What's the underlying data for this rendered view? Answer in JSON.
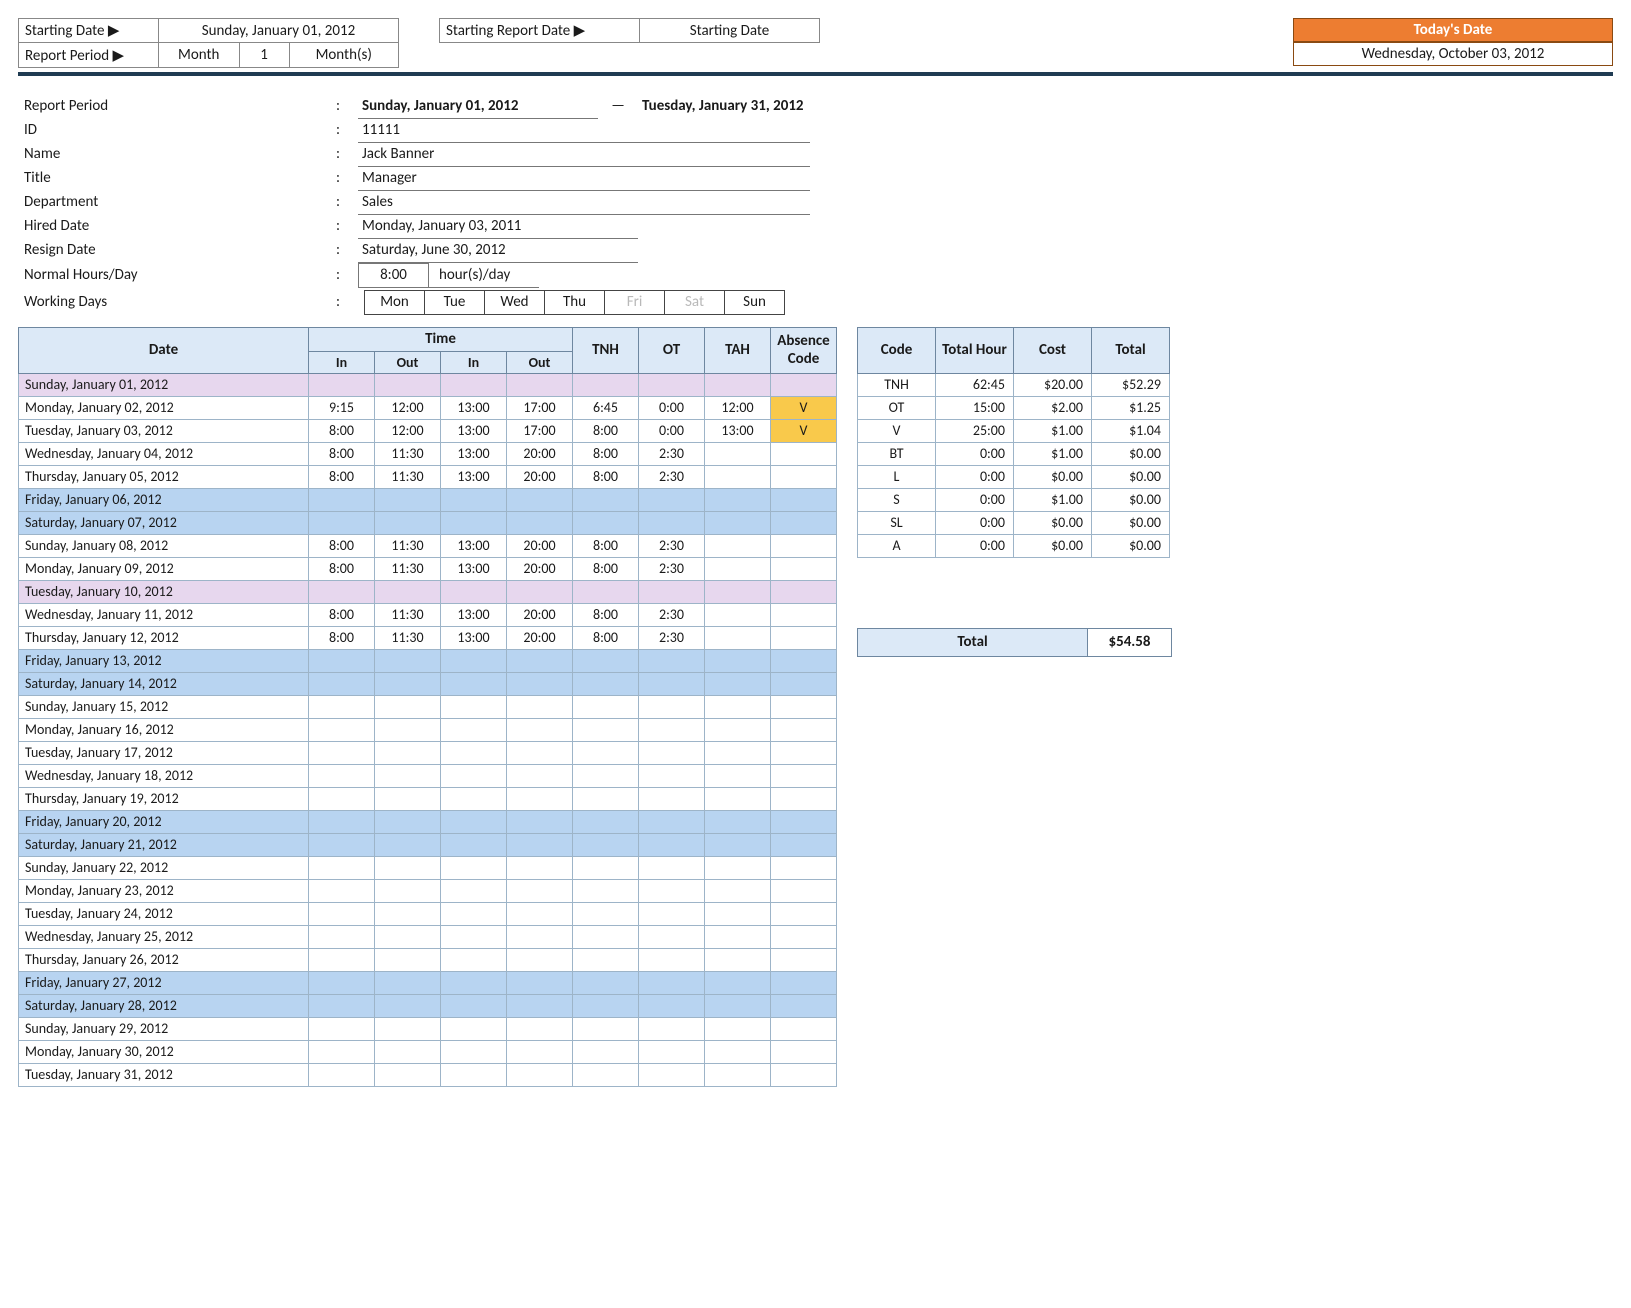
{
  "top": {
    "starting_date_label": "Starting Date ▶",
    "starting_date_value": "Sunday, January 01, 2012",
    "report_period_label": "Report Period ▶",
    "report_period_unit": "Month",
    "report_period_count": "1",
    "report_period_suffix": "Month(s)",
    "starting_report_label": "Starting Report Date ▶",
    "starting_report_value": "Starting Date",
    "today_header": "Today's Date",
    "today_value": "Wednesday, October 03, 2012"
  },
  "info": {
    "period_label": "Report Period",
    "period_from": "Sunday, January 01, 2012",
    "period_dash": "—",
    "period_to": "Tuesday, January 31, 2012",
    "id_label": "ID",
    "id_value": "11111",
    "name_label": "Name",
    "name_value": "Jack Banner",
    "title_label": "Title",
    "title_value": "Manager",
    "dept_label": "Department",
    "dept_value": "Sales",
    "hired_label": "Hired Date",
    "hired_value": "Monday, January 03, 2011",
    "resign_label": "Resign Date",
    "resign_value": "Saturday, June 30, 2012",
    "hours_label": "Normal Hours/Day",
    "hours_value": "8:00",
    "hours_suffix": "hour(s)/day",
    "days_label": "Working Days",
    "days": [
      "Mon",
      "Tue",
      "Wed",
      "Thu",
      "Fri",
      "Sat",
      "Sun"
    ],
    "days_off": [
      false,
      false,
      false,
      false,
      true,
      true,
      false
    ]
  },
  "sheet": {
    "headers": {
      "date": "Date",
      "time": "Time",
      "in": "In",
      "out": "Out",
      "tnh": "TNH",
      "ot": "OT",
      "tah": "TAH",
      "abs": "Absence Code"
    },
    "rows": [
      {
        "date": "Sunday, January 01, 2012",
        "cls": "sun"
      },
      {
        "date": "Monday, January 02, 2012",
        "in1": "9:15",
        "out1": "12:00",
        "in2": "13:00",
        "out2": "17:00",
        "tnh": "6:45",
        "ot": "0:00",
        "tah": "12:00",
        "abs": "V"
      },
      {
        "date": "Tuesday, January 03, 2012",
        "in1": "8:00",
        "out1": "12:00",
        "in2": "13:00",
        "out2": "17:00",
        "tnh": "8:00",
        "ot": "0:00",
        "tah": "13:00",
        "abs": "V"
      },
      {
        "date": "Wednesday, January 04, 2012",
        "in1": "8:00",
        "out1": "11:30",
        "in2": "13:00",
        "out2": "20:00",
        "tnh": "8:00",
        "ot": "2:30"
      },
      {
        "date": "Thursday, January 05, 2012",
        "in1": "8:00",
        "out1": "11:30",
        "in2": "13:00",
        "out2": "20:00",
        "tnh": "8:00",
        "ot": "2:30"
      },
      {
        "date": "Friday, January 06, 2012",
        "cls": "fri"
      },
      {
        "date": "Saturday, January 07, 2012",
        "cls": "sat"
      },
      {
        "date": "Sunday, January 08, 2012",
        "in1": "8:00",
        "out1": "11:30",
        "in2": "13:00",
        "out2": "20:00",
        "tnh": "8:00",
        "ot": "2:30"
      },
      {
        "date": "Monday, January 09, 2012",
        "in1": "8:00",
        "out1": "11:30",
        "in2": "13:00",
        "out2": "20:00",
        "tnh": "8:00",
        "ot": "2:30"
      },
      {
        "date": "Tuesday, January 10, 2012",
        "cls": "sun"
      },
      {
        "date": "Wednesday, January 11, 2012",
        "in1": "8:00",
        "out1": "11:30",
        "in2": "13:00",
        "out2": "20:00",
        "tnh": "8:00",
        "ot": "2:30"
      },
      {
        "date": "Thursday, January 12, 2012",
        "in1": "8:00",
        "out1": "11:30",
        "in2": "13:00",
        "out2": "20:00",
        "tnh": "8:00",
        "ot": "2:30"
      },
      {
        "date": "Friday, January 13, 2012",
        "cls": "fri"
      },
      {
        "date": "Saturday, January 14, 2012",
        "cls": "sat"
      },
      {
        "date": "Sunday, January 15, 2012"
      },
      {
        "date": "Monday, January 16, 2012"
      },
      {
        "date": "Tuesday, January 17, 2012"
      },
      {
        "date": "Wednesday, January 18, 2012"
      },
      {
        "date": "Thursday, January 19, 2012"
      },
      {
        "date": "Friday, January 20, 2012",
        "cls": "fri"
      },
      {
        "date": "Saturday, January 21, 2012",
        "cls": "sat"
      },
      {
        "date": "Sunday, January 22, 2012"
      },
      {
        "date": "Monday, January 23, 2012"
      },
      {
        "date": "Tuesday, January 24, 2012"
      },
      {
        "date": "Wednesday, January 25, 2012"
      },
      {
        "date": "Thursday, January 26, 2012"
      },
      {
        "date": "Friday, January 27, 2012",
        "cls": "fri"
      },
      {
        "date": "Saturday, January 28, 2012",
        "cls": "sat"
      },
      {
        "date": "Sunday, January 29, 2012"
      },
      {
        "date": "Monday, January 30, 2012"
      },
      {
        "date": "Tuesday, January 31, 2012"
      }
    ]
  },
  "summary": {
    "headers": {
      "code": "Code",
      "hour": "Total Hour",
      "cost": "Cost",
      "total": "Total"
    },
    "rows": [
      {
        "code": "TNH",
        "hour": "62:45",
        "cost": "$20.00",
        "total": "$52.29"
      },
      {
        "code": "OT",
        "hour": "15:00",
        "cost": "$2.00",
        "total": "$1.25"
      },
      {
        "code": "V",
        "hour": "25:00",
        "cost": "$1.00",
        "total": "$1.04"
      },
      {
        "code": "BT",
        "hour": "0:00",
        "cost": "$1.00",
        "total": "$0.00"
      },
      {
        "code": "L",
        "hour": "0:00",
        "cost": "$0.00",
        "total": "$0.00"
      },
      {
        "code": "S",
        "hour": "0:00",
        "cost": "$1.00",
        "total": "$0.00"
      },
      {
        "code": "SL",
        "hour": "0:00",
        "cost": "$0.00",
        "total": "$0.00"
      },
      {
        "code": "A",
        "hour": "0:00",
        "cost": "$0.00",
        "total": "$0.00"
      }
    ],
    "grand_label": "Total",
    "grand_value": "$54.58"
  }
}
